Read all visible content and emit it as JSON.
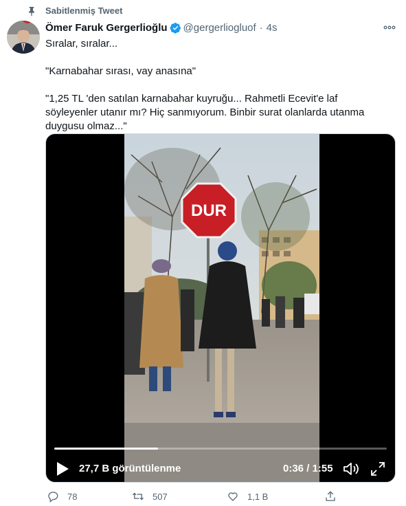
{
  "pinned": {
    "label": "Sabitlenmiş Tweet",
    "icon": "pin-icon"
  },
  "author": {
    "name": "Ömer Faruk Gergerlioğlu",
    "handle": "@gergerliogluof",
    "verified_icon": "verified-badge-icon",
    "avatar_icon": "profile-avatar"
  },
  "post": {
    "time": "4s",
    "separator": "·",
    "lines": [
      "Sıralar, sıralar...",
      "\"Karnabahar sırası, vay anasına\"",
      "\"1,25 TL 'den satılan karnabahar kuyruğu...  Rahmetli Ecevit'e laf söyleyenler utanır mı? Hiç sanmıyorum. Binbir surat olanlarda utanma duygusu olmaz...\""
    ]
  },
  "video": {
    "sign_text": "DUR",
    "views": "27,7 B görüntülenme",
    "time": "0:36 / 1:55",
    "progress": 0.3127
  },
  "actions": {
    "reply_count": "78",
    "retweet_count": "507",
    "like_count": "1,1 B"
  },
  "colors": {
    "text_primary": "#0f1419",
    "text_secondary": "#536471",
    "verified": "#1d9bf0",
    "sign_red": "#c81e26"
  }
}
